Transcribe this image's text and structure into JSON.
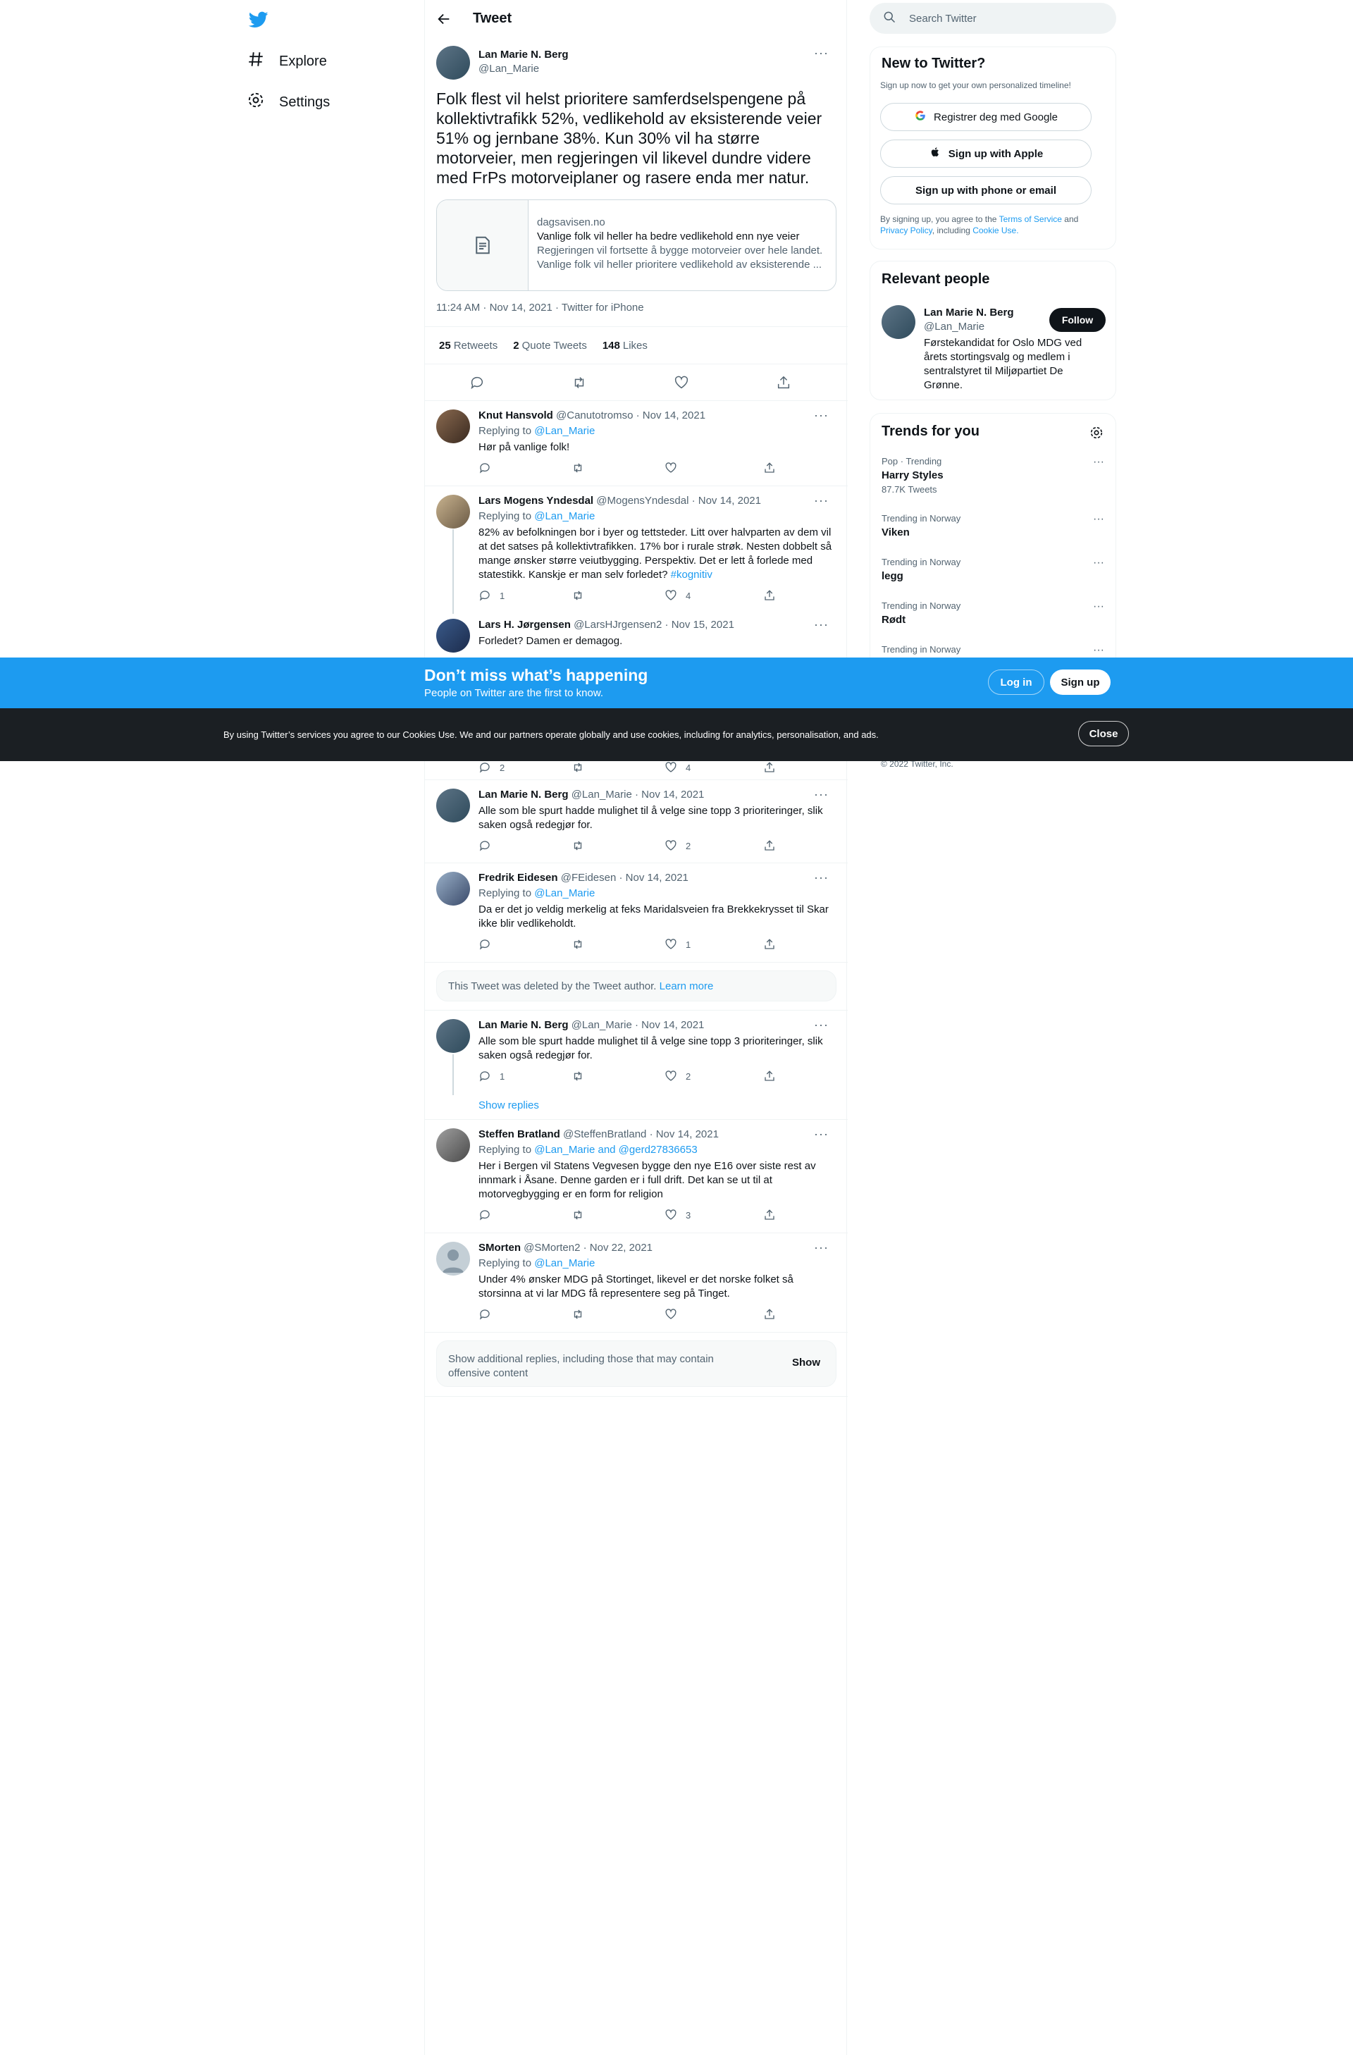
{
  "nav": {
    "explore": "Explore",
    "settings": "Settings"
  },
  "header": {
    "title": "Tweet"
  },
  "focal": {
    "name": "Lan Marie N. Berg",
    "handle": "@Lan_Marie",
    "text": "Folk flest vil helst prioritere samferdselspengene på kollektivtrafikk 52%, vedlikehold av eksisterende veier 51% og jernbane 38%. Kun 30% vil ha større motorveier, men regjeringen vil likevel dundre videre med FrPs motorveiplaner og rasere enda mer natur.",
    "card": {
      "domain": "dagsavisen.no",
      "title": "Vanlige folk vil heller ha bedre vedlikehold enn nye veier",
      "desc1": "Regjeringen vil fortsette å bygge motorveier over hele landet.",
      "desc2": "Vanlige folk vil heller prioritere vedlikehold av eksisterende ..."
    },
    "meta": "11:24 AM · Nov 14, 2021 · Twitter for iPhone",
    "retweets": "25",
    "retweets_label": "Retweets",
    "quotes": "2",
    "quotes_label": "Quote Tweets",
    "likes": "148",
    "likes_label": "Likes"
  },
  "replies": [
    {
      "name": "Knut Hansvold",
      "handle": "@Canutotromso",
      "date": "· Nov 14, 2021",
      "replying": "Replying to",
      "to": "@Lan_Marie",
      "text": "Hør på vanlige folk!",
      "replies": "",
      "likes": ""
    },
    {
      "name": "Lars Mogens Yndesdal",
      "handle": "@MogensYndesdal",
      "date": "· Nov 14, 2021",
      "replying": "Replying to",
      "to": "@Lan_Marie",
      "text": "82% av befolkningen bor i byer og tettsteder. Litt over halvparten av dem vil at det satses på kollektivtrafikken. 17% bor i rurale strøk. Nesten dobbelt så mange ønsker større veiutbygging. Perspektiv. Det er lett å forlede med statestikk. Kanskje er man selv forledet?",
      "hashtag": "#kognitiv",
      "replies": "1",
      "likes": "4"
    },
    {
      "name": "Lars H. Jørgensen",
      "handle": "@LarsHJrgensen2",
      "date": "· Nov 15, 2021",
      "text": "Forledet? Damen er demagog.",
      "replies": "2",
      "likes": "4"
    },
    {
      "name": "Lan Marie N. Berg",
      "handle": "@Lan_Marie",
      "date": "· Nov 14, 2021",
      "text": "Alle som ble spurt hadde mulighet til å velge sine topp 3 prioriteringer, slik saken også redegjør for.",
      "replies": "",
      "likes": "2"
    },
    {
      "name": "Fredrik Eidesen",
      "handle": "@FEidesen",
      "date": "· Nov 14, 2021",
      "replying": "Replying to",
      "to": "@Lan_Marie",
      "text": "Da er det jo veldig merkelig at feks Maridalsveien fra Brekkekrysset til Skar ikke blir vedlikeholdt.",
      "replies": "",
      "likes": "1"
    },
    {
      "name": "Lan Marie N. Berg",
      "handle": "@Lan_Marie",
      "date": "· Nov 14, 2021",
      "text": "Alle som ble spurt hadde mulighet til å velge sine topp 3 prioriteringer, slik saken også redegjør for.",
      "replies": "1",
      "likes": "2",
      "show_replies": "Show replies"
    },
    {
      "name": "Steffen Bratland",
      "handle": "@SteffenBratland",
      "date": "· Nov 14, 2021",
      "replying": "Replying to",
      "to": "@Lan_Marie and @gerd27836653",
      "text": "Her i Bergen vil Statens Vegvesen bygge den nye E16 over siste rest av innmark i Åsane. Denne garden er i full drift. Det kan se ut til at motorvegbygging er en form for religion",
      "replies": "",
      "likes": "3"
    },
    {
      "name": "SMorten",
      "handle": "@SMorten2",
      "date": "· Nov 22, 2021",
      "replying": "Replying to",
      "to": "@Lan_Marie",
      "text": "Under 4% ønsker MDG på Stortinget, likevel er det norske folket så storsinna at vi lar MDG få representere seg på Tinget.",
      "replies": "",
      "likes": ""
    }
  ],
  "deleted": {
    "text": "This Tweet was deleted by the Tweet author.",
    "link": "Learn more"
  },
  "show_more": {
    "text": "Show additional replies, including those that may contain offensive content",
    "button": "Show"
  },
  "sidebar": {
    "search_placeholder": "Search Twitter",
    "new_title": "New to Twitter?",
    "new_sub": "Sign up now to get your own personalized timeline!",
    "google": "Registrer deg med Google",
    "apple": "Sign up with Apple",
    "phone": "Sign up with phone or email",
    "terms_pre": "By signing up, you agree to the",
    "terms_link": "Terms of Service",
    "terms_and": "and",
    "privacy_link": "Privacy Policy",
    "including": ", including",
    "cookie_link": "Cookie Use.",
    "relevant_title": "Relevant people",
    "person_name": "Lan Marie N. Berg",
    "person_handle": "@Lan_Marie",
    "person_bio": "Førstekandidat for Oslo MDG ved årets stortingsvalg og medlem i sentralstyret til Miljøpartiet De Grønne.",
    "follow": "Follow",
    "trends_title": "Trends for you",
    "trends": [
      {
        "cat": "Pop · Trending",
        "name": "Harry Styles",
        "count": "87.7K Tweets"
      },
      {
        "cat": "Trending in Norway",
        "name": "Viken"
      },
      {
        "cat": "Trending in Norway",
        "name": "legg"
      },
      {
        "cat": "Trending in Norway",
        "name": "Rødt"
      },
      {
        "cat": "Trending in Norway",
        "name": ""
      }
    ],
    "copyright": "© 2022 Twitter, Inc."
  },
  "banner": {
    "title": "Don’t miss what’s happening",
    "sub": "People on Twitter are the first to know.",
    "login": "Log in",
    "signup": "Sign up"
  },
  "cookies": {
    "text": "By using Twitter’s services you agree to our Cookies Use. We and our partners operate globally and use cookies, including for analytics, personalisation, and ads.",
    "close": "Close"
  },
  "colors": {
    "accent": "#1d9bf0",
    "text": "#0f1419",
    "muted": "#536471",
    "border": "#eff3f4"
  }
}
